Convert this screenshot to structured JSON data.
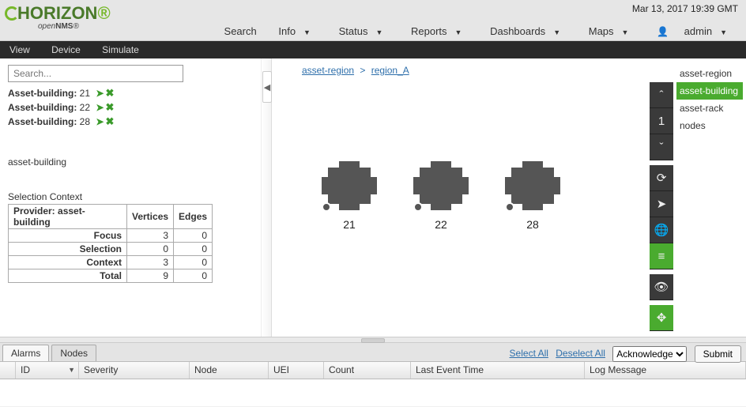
{
  "timestamp": "Mar 13, 2017 19:39 GMT",
  "logo": {
    "main": "HORIZON",
    "sub_prefix": "open",
    "sub_bold": "NMS"
  },
  "nav": {
    "search": "Search",
    "info": "Info",
    "status": "Status",
    "reports": "Reports",
    "dashboards": "Dashboards",
    "maps": "Maps",
    "user": "admin"
  },
  "menubar": {
    "view": "View",
    "device": "Device",
    "simulate": "Simulate"
  },
  "search": {
    "placeholder": "Search..."
  },
  "focus": {
    "label_prefix": "Asset-building:",
    "items": [
      {
        "id": "21"
      },
      {
        "id": "22"
      },
      {
        "id": "28"
      }
    ]
  },
  "layerTitle": "asset-building",
  "selection": {
    "title": "Selection Context",
    "headers": {
      "provider_label": "Provider:",
      "provider_value": "asset-building",
      "vertices": "Vertices",
      "edges": "Edges"
    },
    "rows": [
      {
        "label": "Focus",
        "vertices": 3,
        "edges": 0
      },
      {
        "label": "Selection",
        "vertices": 0,
        "edges": 0
      },
      {
        "label": "Context",
        "vertices": 3,
        "edges": 0
      },
      {
        "label": "Total",
        "vertices": 9,
        "edges": 0
      }
    ]
  },
  "breadcrumb": {
    "root": "asset-region",
    "sep": ">",
    "current": "region_A"
  },
  "graphNodes": [
    {
      "label": "21"
    },
    {
      "label": "22"
    },
    {
      "label": "28"
    }
  ],
  "semanticZoom": "1",
  "layers": {
    "items": [
      "asset-region",
      "asset-building",
      "asset-rack",
      "nodes"
    ],
    "selectedIndex": 1
  },
  "bottomTabs": {
    "alarms": "Alarms",
    "nodes": "Nodes"
  },
  "alarmActions": {
    "selectAll": "Select All",
    "deselectAll": "Deselect All",
    "ackOption": "Acknowledge",
    "submit": "Submit"
  },
  "alarmCols": {
    "id": "ID",
    "severity": "Severity",
    "node": "Node",
    "uei": "UEI",
    "count": "Count",
    "lastEvent": "Last Event Time",
    "logMsg": "Log Message"
  }
}
